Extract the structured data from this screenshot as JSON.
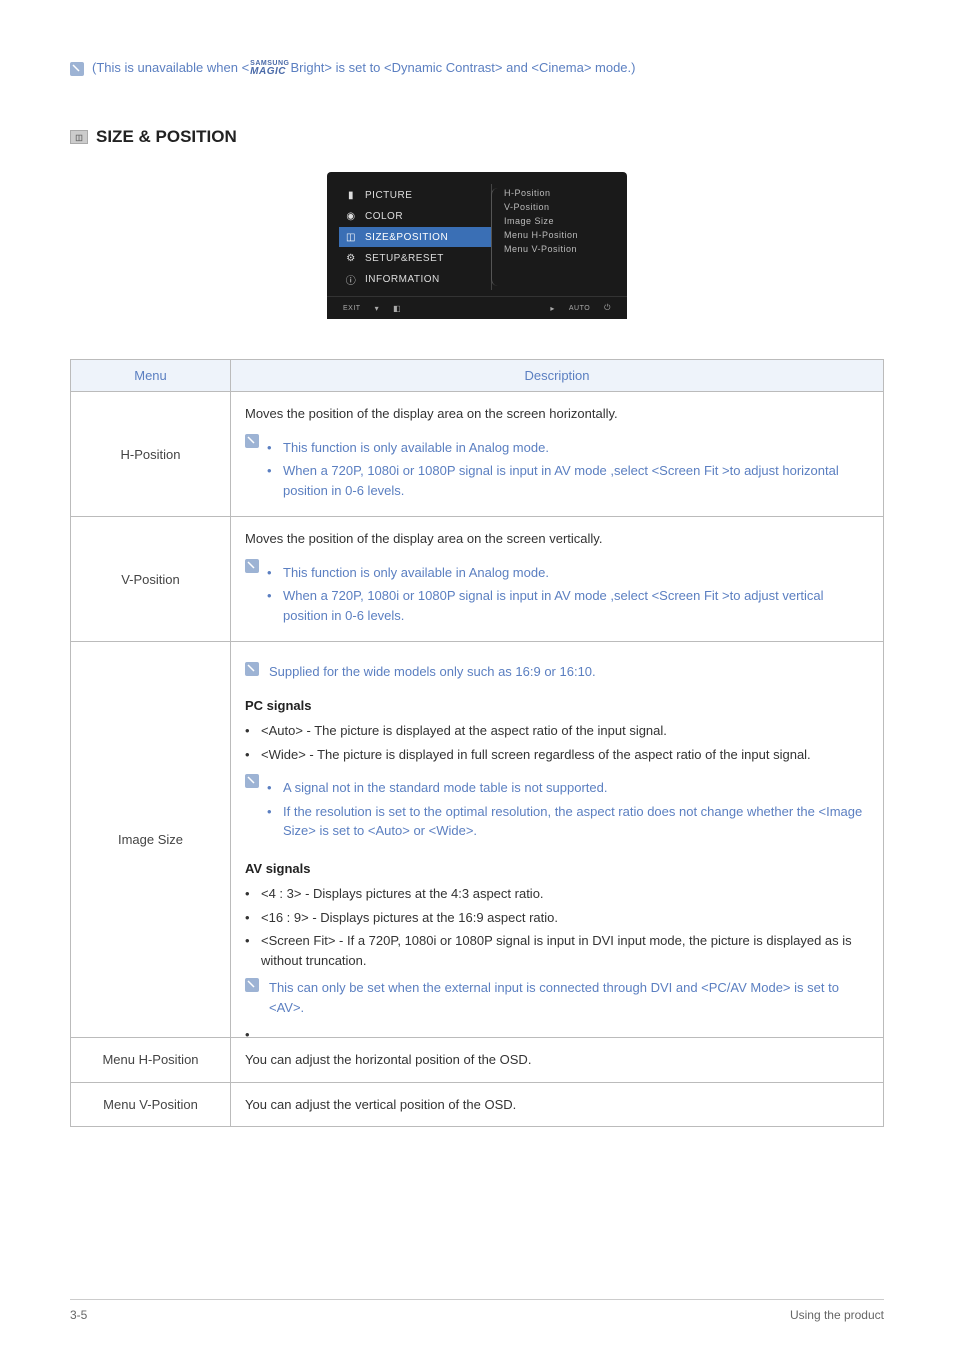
{
  "top_note": {
    "prefix": "(This is unavailable when <",
    "brand_top": "SAMSUNG",
    "brand_bottom": "MAGIC",
    "suffix": "Bright> is set to <Dynamic Contrast> and <Cinema> mode.)"
  },
  "heading": "SIZE & POSITION",
  "osd": {
    "left": [
      {
        "icon": "▮",
        "label": "PICTURE"
      },
      {
        "icon": "◉",
        "label": "COLOR"
      },
      {
        "icon": "◫",
        "label": "SIZE&POSITION",
        "selected": true
      },
      {
        "icon": "⚙",
        "label": "SETUP&RESET"
      },
      {
        "icon": "ⓘ",
        "label": "INFORMATION"
      }
    ],
    "right": [
      "H-Position",
      "V-Position",
      "Image Size",
      "Menu H-Position",
      "Menu V-Position"
    ],
    "footer_left": [
      "EXIT"
    ],
    "footer_right": [
      "AUTO",
      "⏻"
    ]
  },
  "table": {
    "header": {
      "menu": "Menu",
      "desc": "Description"
    },
    "rows": [
      {
        "menu": "H-Position",
        "intro": "Moves the position of the display area on the screen horizontally.",
        "notes": [
          "This function is only available in Analog mode.",
          "When a 720P, 1080i or 1080P signal is input in AV mode ,select <Screen Fit >to adjust horizontal position in 0-6 levels."
        ]
      },
      {
        "menu": "V-Position",
        "intro": "Moves the position of the display area on the screen vertically.",
        "notes": [
          "This function is only available in Analog mode.",
          "When a 720P, 1080i or 1080P signal is input in AV mode ,select <Screen Fit >to adjust vertical position in 0-6 levels."
        ]
      },
      {
        "menu": "Image Size",
        "top_note": "Supplied for the wide models only such as 16:9 or 16:10.",
        "pc_heading": "PC signals",
        "pc_items": [
          "<Auto> - The picture is displayed at the aspect ratio of the input signal.",
          "<Wide> - The picture is displayed in full screen regardless of the aspect ratio of the input signal."
        ],
        "pc_notes": [
          "A signal not in the standard mode table is not supported.",
          "If the resolution is set to the optimal resolution, the aspect ratio does not change whether the <Image Size> is set to <Auto> or <Wide>."
        ],
        "av_heading": "AV signals",
        "av_items": [
          "<4 : 3> - Displays pictures at the 4:3 aspect ratio.",
          "<16 : 9> - Displays pictures at the 16:9 aspect ratio.",
          "<Screen Fit> - If a 720P, 1080i or 1080P signal is input in DVI input mode, the picture is displayed as is without truncation."
        ],
        "av_note": "This can only be set when the external input is connected through DVI and <PC/AV Mode> is set to <AV>."
      },
      {
        "menu": "Menu H-Position",
        "intro": "You can adjust the horizontal position of the OSD."
      },
      {
        "menu": "Menu V-Position",
        "intro": "You can adjust the vertical position of the OSD."
      }
    ]
  },
  "footer": {
    "left": "3-5",
    "right": "Using the product"
  }
}
